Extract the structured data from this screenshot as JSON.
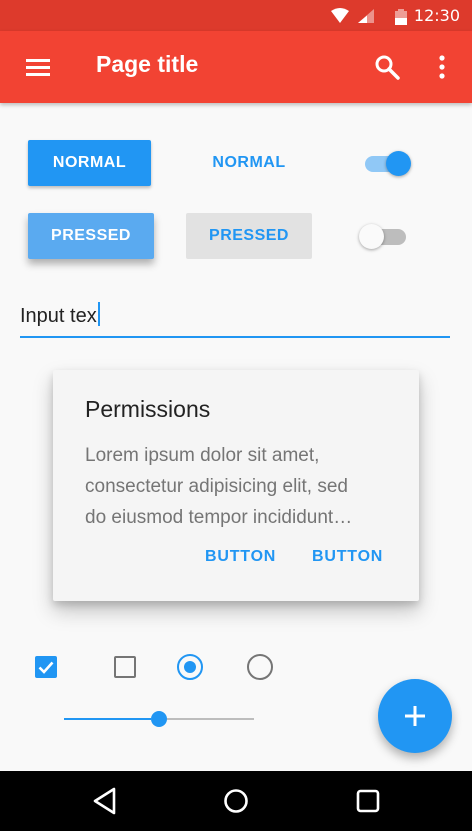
{
  "status_bar": {
    "time": "12:30"
  },
  "app_bar": {
    "title": "Page title"
  },
  "buttons": {
    "raised_normal": "NORMAL",
    "flat_normal": "NORMAL",
    "raised_pressed": "PRESSED",
    "flat_pressed": "PRESSED"
  },
  "switches": {
    "on": true,
    "off": false
  },
  "input": {
    "value": "Input tex"
  },
  "dialog": {
    "title": "Permissions",
    "body_line1": "Lorem ipsum dolor sit amet,",
    "body_line2": "consectetur adipisicing elit, sed",
    "body_line3": "do eiusmod tempor incididunt…",
    "button1": "BUTTON",
    "button2": "BUTTON"
  },
  "checkboxes": {
    "first_checked": true,
    "second_checked": false
  },
  "radios": {
    "first_selected": true,
    "second_selected": false
  },
  "slider": {
    "value": 0.5
  },
  "colors": {
    "primary": "#f24333",
    "primary_dark": "#dd3a2c",
    "accent": "#2196f3"
  },
  "icons": {
    "menu": "menu-icon",
    "search": "search-icon",
    "overflow": "more-vert-icon",
    "fab": "plus-icon",
    "nav_back": "back-triangle-icon",
    "nav_home": "home-circle-icon",
    "nav_recents": "recents-square-icon"
  }
}
